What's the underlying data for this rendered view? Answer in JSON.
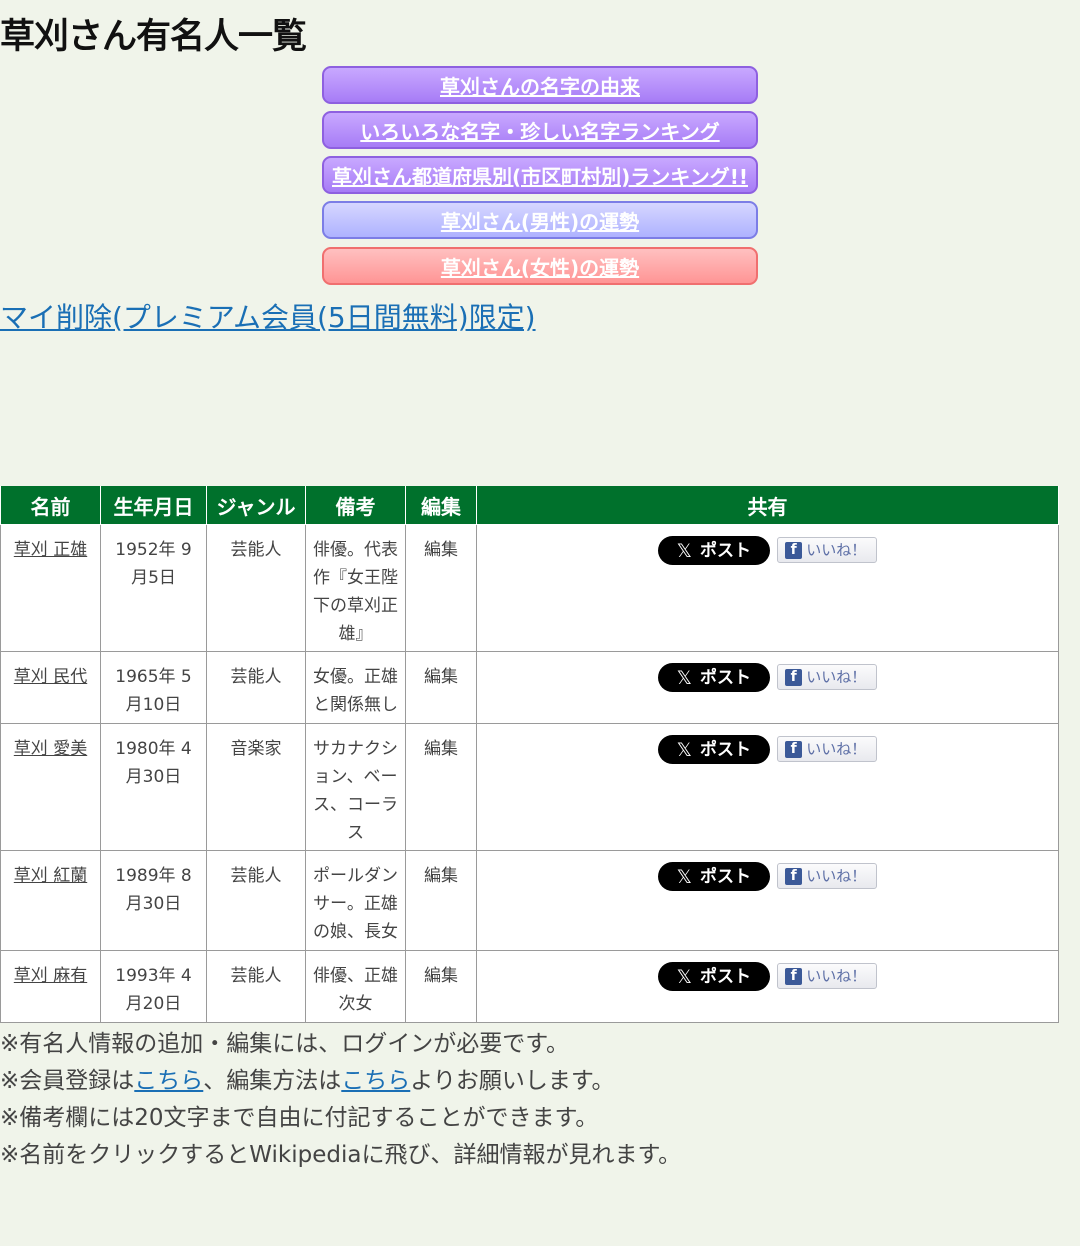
{
  "page": {
    "title": "草刈さん有名人一覧"
  },
  "nav": {
    "buttons": [
      {
        "label": "草刈さんの名字の由来"
      },
      {
        "label": "いろいろな名字・珍しい名字ランキング"
      },
      {
        "label": "草刈さん都道府県別(市区町村別)ランキング!!"
      },
      {
        "label": "草刈さん(男性)の運勢"
      },
      {
        "label": "草刈さん(女性)の運勢"
      }
    ]
  },
  "my_delete_link": "マイ削除(プレミアム会員(5日間無料)限定)",
  "table": {
    "headers": [
      "名前",
      "生年月日",
      "ジャンル",
      "備考",
      "編集",
      "共有"
    ],
    "rows": [
      {
        "name": "草刈 正雄",
        "birth": "1952年 9月5日",
        "genre": "芸能人",
        "note": "俳優。代表作『女王陛下の草刈正雄』",
        "edit": "編集"
      },
      {
        "name": "草刈 民代",
        "birth": "1965年 5月10日",
        "genre": "芸能人",
        "note": "女優。正雄と関係無し",
        "edit": "編集"
      },
      {
        "name": "草刈 愛美",
        "birth": "1980年 4月30日",
        "genre": "音楽家",
        "note": "サカナクション、ベース、コーラス",
        "edit": "編集"
      },
      {
        "name": "草刈 紅蘭",
        "birth": "1989年 8月30日",
        "genre": "芸能人",
        "note": "ポールダンサー。正雄の娘、長女",
        "edit": "編集"
      },
      {
        "name": "草刈 麻有",
        "birth": "1993年 4月20日",
        "genre": "芸能人",
        "note": "俳優、正雄次女",
        "edit": "編集"
      }
    ],
    "share": {
      "x_label": "ポスト",
      "x_icon": "x-logo-icon",
      "fb_label": "いいね！",
      "fb_icon": "facebook-icon"
    }
  },
  "notes": {
    "line1": "※有名人情報の追加・編集には、ログインが必要です。",
    "line2_a": "※会員登録は",
    "line2_link1": "こちら",
    "line2_b": "、編集方法は",
    "line2_link2": "こちら",
    "line2_c": "よりお願いします。",
    "line3": "※備考欄には20文字まで自由に付記することができます。",
    "line4": "※名前をクリックするとWikipediaに飛び、詳細情報が見れます。"
  },
  "colors": {
    "background": "#f0f4ea",
    "table_header": "#00712c",
    "link": "#1a6fb5",
    "nav_purple": "#a77cf6",
    "nav_blue": "#aeb2ff",
    "nav_pink": "#ff9595"
  }
}
